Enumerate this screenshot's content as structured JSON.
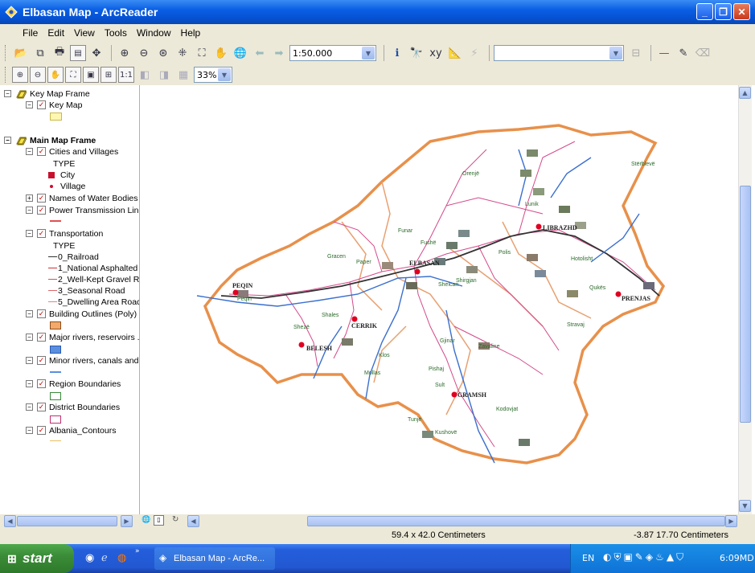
{
  "window": {
    "title": "Elbasan Map - ArcReader"
  },
  "menu": [
    "File",
    "Edit",
    "View",
    "Tools",
    "Window",
    "Help"
  ],
  "toolbar": {
    "scale": "1:50.000",
    "zoom_percent": "33%",
    "search_value": ""
  },
  "toc": {
    "key_map_frame": "Key Map Frame",
    "key_map": "Key Map",
    "main_map_frame": "Main Map Frame",
    "layers": [
      {
        "label": "Cities and Villages",
        "state": "-"
      },
      {
        "label": "TYPE"
      },
      {
        "label": "City"
      },
      {
        "label": "Village"
      },
      {
        "label": "Names of Water Bodies",
        "state": "+"
      },
      {
        "label": "Power Transmission Line",
        "state": "-"
      },
      {
        "label": "Transportation",
        "state": "-"
      },
      {
        "label": "TYPE"
      },
      {
        "label": "0_Railroad"
      },
      {
        "label": "1_National Asphalted"
      },
      {
        "label": "2_Well-Kept Gravel R"
      },
      {
        "label": "3_Seasonal Road"
      },
      {
        "label": "5_Dwelling Area Roac"
      },
      {
        "label": "Building Outlines (Poly)",
        "state": "-"
      },
      {
        "label": "Major rivers, reservoirs ."
      },
      {
        "label": "Minor rivers, canals and"
      },
      {
        "label": "Region Boundaries"
      },
      {
        "label": "District Boundaries"
      },
      {
        "label": "Albania_Contours"
      }
    ]
  },
  "map_labels": {
    "cities": [
      "ELBASAN",
      "LIBRAZHD",
      "PEQIN",
      "CERRIK",
      "BELESH",
      "GRAMSH",
      "PRENJAS"
    ],
    "places": [
      "Orenjë",
      "Stërblevë",
      "Lunik",
      "Funar",
      "Gracen",
      "Paper",
      "Fushë",
      "Polis",
      "Hotolisht",
      "Qukës",
      "Shelcan",
      "Shirgjan",
      "Shales",
      "Shezë",
      "Gjinar",
      "Zavaline",
      "Stravaj",
      "Klos",
      "Mollas",
      "Pishaj",
      "Sult",
      "Kodovjat",
      "Tunjë",
      "Kushovë",
      "Pëqin"
    ]
  },
  "status": {
    "page_size": "59.4 x 42.0 Centimeters",
    "cursor": "-3.87  17.70 Centimeters"
  },
  "taskbar": {
    "start_label": "start",
    "task_label": "Elbasan Map - ArcRe...",
    "lang": "EN",
    "clock": "6:09MD"
  },
  "colors": {
    "titlebar": "#0a5fe4",
    "district_boundary": "#e8904a",
    "roads": "#d44a8a",
    "rivers": "#3a6fcf",
    "city_marker": "#e00020"
  }
}
